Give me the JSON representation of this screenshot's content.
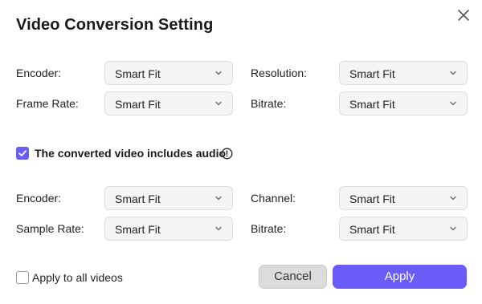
{
  "dialog": {
    "title": "Video Conversion Setting",
    "close_icon": "close-icon"
  },
  "video": {
    "encoder_label": "Encoder:",
    "encoder_value": "Smart Fit",
    "resolution_label": "Resolution:",
    "resolution_value": "Smart Fit",
    "frame_rate_label": "Frame Rate:",
    "frame_rate_value": "Smart Fit",
    "bitrate_label": "Bitrate:",
    "bitrate_value": "Smart Fit"
  },
  "audio_toggle": {
    "label": "The converted video includes audio",
    "checked": true,
    "info_icon": "info-icon"
  },
  "audio": {
    "encoder_label": "Encoder:",
    "encoder_value": "Smart Fit",
    "channel_label": "Channel:",
    "channel_value": "Smart Fit",
    "sample_rate_label": "Sample Rate:",
    "sample_rate_value": "Smart Fit",
    "bitrate_label": "Bitrate:",
    "bitrate_value": "Smart Fit"
  },
  "footer": {
    "apply_all_label": "Apply to all videos",
    "apply_all_checked": false,
    "cancel_label": "Cancel",
    "apply_label": "Apply"
  },
  "colors": {
    "accent": "#6a5cf6",
    "select_bg": "#f5f5f5",
    "cancel_bg": "#dcdcdc"
  }
}
